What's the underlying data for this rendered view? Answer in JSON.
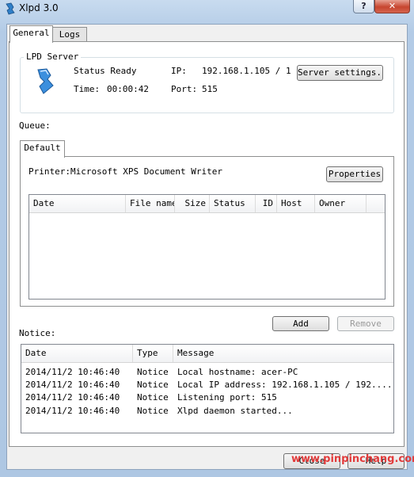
{
  "window": {
    "title": "Xlpd 3.0",
    "help_label": "?",
    "close_label": "✕"
  },
  "tabs": [
    {
      "label": "General"
    },
    {
      "label": "Logs"
    }
  ],
  "lpd_server": {
    "legend": "LPD Server",
    "status": "Status Ready",
    "time_label": "Time:",
    "time_value": "00:00:42",
    "ip_label": "IP:",
    "ip_value": "192.168.1.105 / 1",
    "port_label": "Port:",
    "port_value": "515",
    "settings_button": "Server settings..."
  },
  "queue": {
    "label": "Queue:",
    "tab": "Default",
    "printer": "Printer:Microsoft XPS Document Writer",
    "properties_button": "Properties",
    "columns": [
      "Date",
      "File name",
      "Size",
      "Status",
      "ID",
      "Host",
      "Owner"
    ],
    "add_button": "Add",
    "remove_button": "Remove"
  },
  "notice": {
    "label": "Notice:",
    "columns": [
      "Date",
      "Type",
      "Message"
    ],
    "rows": [
      {
        "date": "2014/11/2 10:46:40",
        "type": "Notice",
        "message": "Local hostname: acer-PC"
      },
      {
        "date": "2014/11/2 10:46:40",
        "type": "Notice",
        "message": "Local IP address: 192.168.1.105 / 192...."
      },
      {
        "date": "2014/11/2 10:46:40",
        "type": "Notice",
        "message": "Listening port: 515"
      },
      {
        "date": "2014/11/2 10:46:40",
        "type": "Notice",
        "message": "Xlpd daemon started..."
      }
    ]
  },
  "footer": {
    "close_button": "Close",
    "help_button": "Help"
  },
  "watermark": "www.pinpinchang.com"
}
